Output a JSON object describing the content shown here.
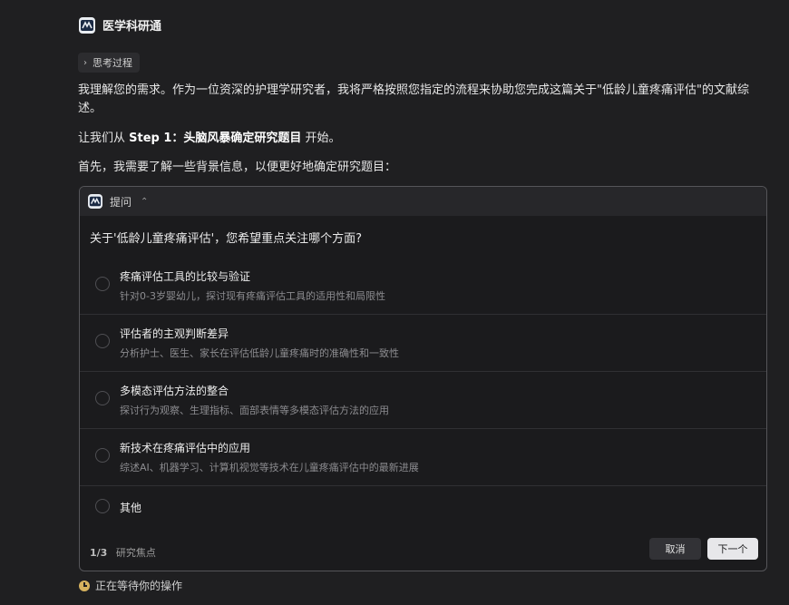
{
  "app": {
    "name": "医学科研通"
  },
  "thinking": {
    "label": "思考过程"
  },
  "message": {
    "p1": "我理解您的需求。作为一位资深的护理学研究者，我将严格按照您指定的流程来协助您完成这篇关于\"低龄儿童疼痛评估\"的文献综述。",
    "p2_prefix": "让我们从 ",
    "p2_bold": "Step 1：头脑风暴确定研究题目",
    "p2_suffix": " 开始。",
    "p3": "首先，我需要了解一些背景信息，以便更好地确定研究题目："
  },
  "card": {
    "title": "提问",
    "question": "关于'低龄儿童疼痛评估'，您希望重点关注哪个方面?",
    "options": [
      {
        "title": "疼痛评估工具的比较与验证",
        "desc": "针对0-3岁婴幼儿，探讨现有疼痛评估工具的适用性和局限性"
      },
      {
        "title": "评估者的主观判断差异",
        "desc": "分析护士、医生、家长在评估低龄儿童疼痛时的准确性和一致性"
      },
      {
        "title": "多模态评估方法的整合",
        "desc": "探讨行为观察、生理指标、面部表情等多模态评估方法的应用"
      },
      {
        "title": "新技术在疼痛评估中的应用",
        "desc": "综述AI、机器学习、计算机视觉等技术在儿童疼痛评估中的最新进展"
      },
      {
        "title": "其他"
      }
    ],
    "pager": "1/3",
    "focus": "研究焦点",
    "cancel_label": "取消",
    "next_label": "下一个"
  },
  "status": {
    "text": "正在等待你的操作"
  },
  "colors": {
    "background": "#1f1f21",
    "card_border": "#555559",
    "status_icon": "#d6b25e"
  },
  "icons": {
    "logo": "app-logo-icon",
    "chevron": "chevron-right-icon",
    "collapse": "collapse-icon",
    "status": "clock-icon"
  }
}
